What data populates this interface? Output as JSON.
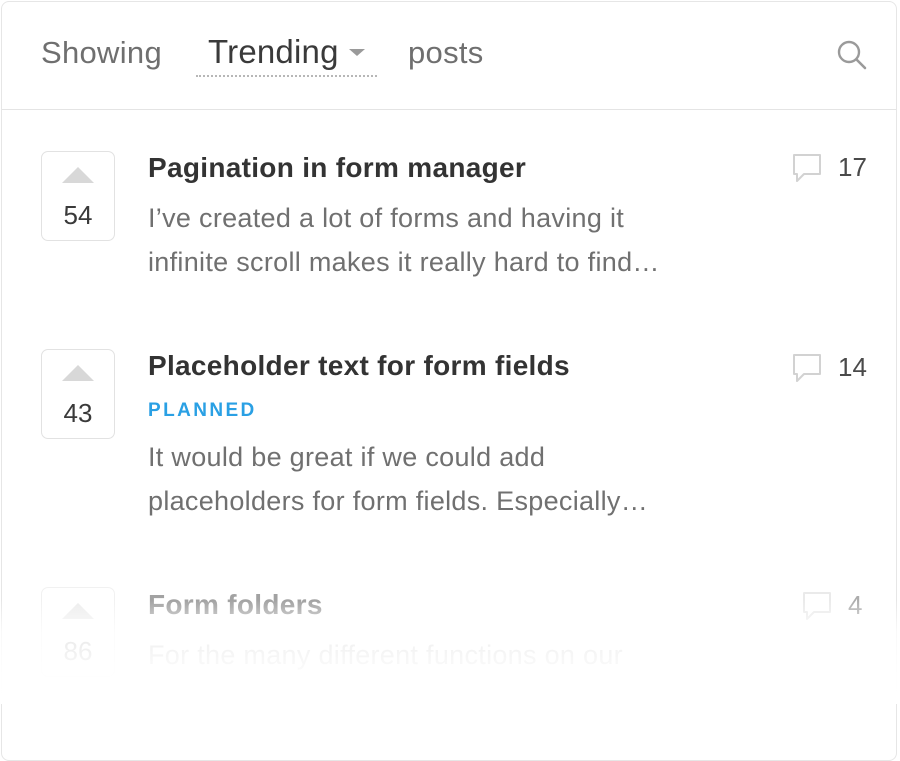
{
  "header": {
    "showing_label": "Showing",
    "filter_value": "Trending",
    "posts_label": "posts",
    "search_icon": "search-icon"
  },
  "posts": [
    {
      "votes": "54",
      "title": "Pagination in form manager",
      "status": "",
      "excerpt_line1": "I’ve created a lot of forms and having it",
      "excerpt_line2": "infinite scroll makes it really hard to find…",
      "comments": "17"
    },
    {
      "votes": "43",
      "title": "Placeholder text for form fields",
      "status": "PLANNED",
      "excerpt_line1": "It would be great if we could add",
      "excerpt_line2": "placeholders for form fields. Especially…",
      "comments": "14"
    },
    {
      "votes": "86",
      "title": "Form folders",
      "status": "",
      "excerpt_line1": "For the many different functions on our",
      "excerpt_line2": "",
      "comments": "4"
    }
  ],
  "colors": {
    "status_planned": "#2aa0e4",
    "title": "#333333",
    "excerpt": "#707070",
    "border": "#e2e2e2"
  }
}
